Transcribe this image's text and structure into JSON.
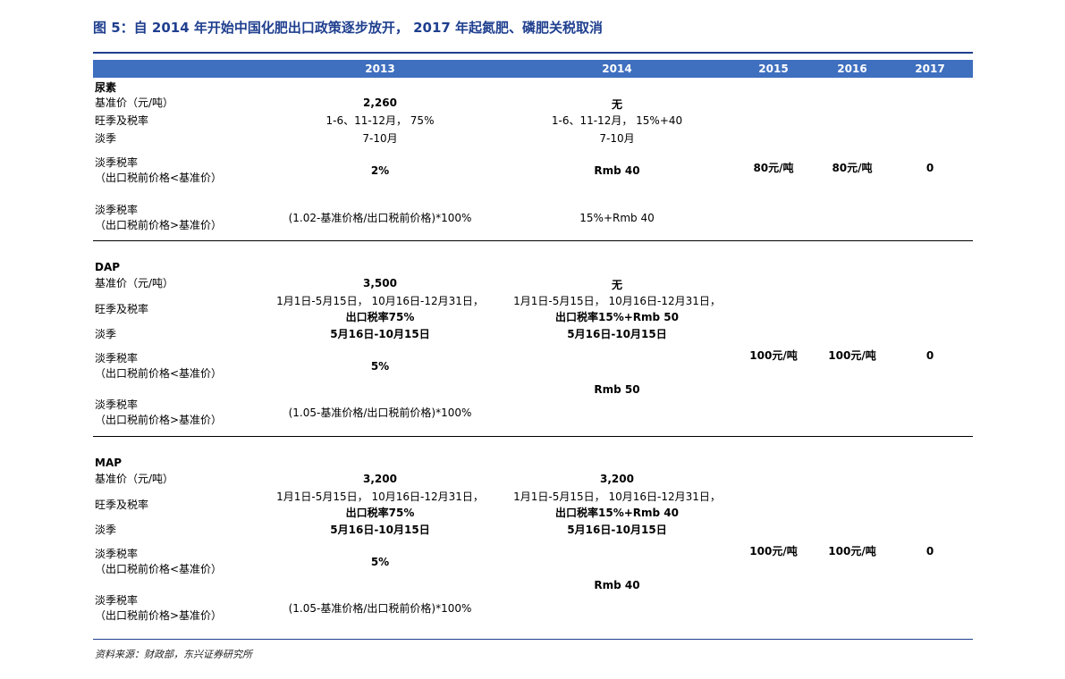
{
  "title": "图 5：自 2014 年开始中国化肥出口政策逐步放开， 2017 年起氮肥、磷肥关税取消",
  "headers": [
    "2013",
    "2014",
    "2015",
    "2016",
    "2017"
  ],
  "urea": {
    "name": "尿素",
    "base_label": "基准价（元/吨）",
    "base_2013": "2,260",
    "base_2014": "无",
    "peak_label": "旺季及税率",
    "peak_2013": "1-6、11-12月， 75%",
    "peak_2014": "1-6、11-12月， 15%+40",
    "off_label": "淡季",
    "off_2013": "7-10月",
    "off_2014": "7-10月",
    "rate1_label_a": "淡季税率",
    "rate1_label_b": "（出口税前价格<基准价）",
    "rate1_2013": "2%",
    "rate1_2014": "Rmb 40",
    "rate_2015": "80元/吨",
    "rate_2016": "80元/吨",
    "rate_2017": "0",
    "rate2_label_a": "淡季税率",
    "rate2_label_b": "（出口税前价格>基准价）",
    "rate2_2013": "(1.02-基准价格/出口税前价格)*100%",
    "rate2_2014": "15%+Rmb 40"
  },
  "dap": {
    "name": "DAP",
    "base_label": "基准价（元/吨）",
    "base_2013": "3,500",
    "base_2014": "无",
    "peak_label": "旺季及税率",
    "peak_2013_a": "1月1日-5月15日， 10月16日-12月31日，",
    "peak_2013_b": "出口税率75%",
    "peak_2014_a": "1月1日-5月15日， 10月16日-12月31日，",
    "peak_2014_b": "出口税率15%+Rmb 50",
    "off_label": "淡季",
    "off_2013": "5月16日-10月15日",
    "off_2014": "5月16日-10月15日",
    "rate1_label_a": "淡季税率",
    "rate1_label_b": "（出口税前价格<基准价）",
    "rate1_2013": "5%",
    "rate_2015": "100元/吨",
    "rate_2016": "100元/吨",
    "rate_2017": "0",
    "rate_2014": "Rmb 50",
    "rate2_label_a": "淡季税率",
    "rate2_label_b": "（出口税前价格>基准价）",
    "rate2_2013": "(1.05-基准价格/出口税前价格)*100%"
  },
  "map": {
    "name": "MAP",
    "base_label": "基准价（元/吨）",
    "base_2013": "3,200",
    "base_2014": "3,200",
    "peak_label": "旺季及税率",
    "peak_2013_a": "1月1日-5月15日， 10月16日-12月31日，",
    "peak_2013_b": "出口税率75%",
    "peak_2014_a": "1月1日-5月15日， 10月16日-12月31日，",
    "peak_2014_b": "出口税率15%+Rmb 40",
    "off_label": "淡季",
    "off_2013": "5月16日-10月15日",
    "off_2014": "5月16日-10月15日",
    "rate1_label_a": "淡季税率",
    "rate1_label_b": "（出口税前价格<基准价）",
    "rate1_2013": "5%",
    "rate_2015": "100元/吨",
    "rate_2016": "100元/吨",
    "rate_2017": "0",
    "rate_2014": "Rmb 40",
    "rate2_label_a": "淡季税率",
    "rate2_label_b": "（出口税前价格>基准价）",
    "rate2_2013": "(1.05-基准价格/出口税前价格)*100%"
  },
  "source": "资料来源：财政部，东兴证券研究所"
}
